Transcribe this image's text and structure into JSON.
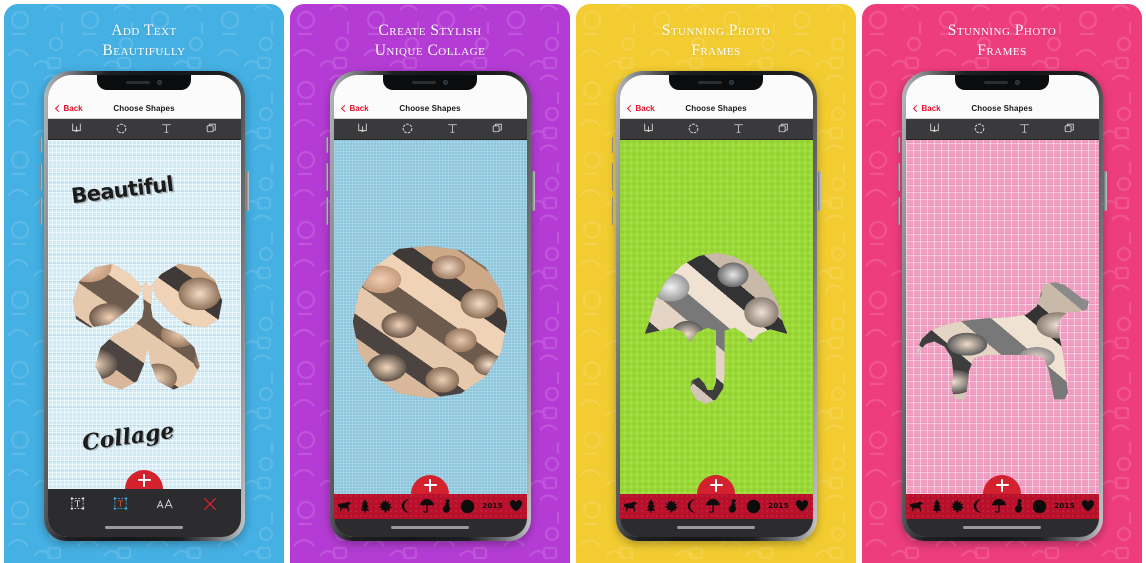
{
  "gallery": {
    "panel_count": 4,
    "panels": [
      {
        "id": "panel-1",
        "bg_color": "#45B0E3",
        "headline": {
          "line1": "Add Text",
          "line2": "Beautifully"
        },
        "phone": {
          "navbar": {
            "back_label": "Back",
            "title": "Choose Shapes"
          },
          "toolbar_icons": [
            "save-icon",
            "shape-circle-icon",
            "text-t-icon",
            "layers-icon"
          ],
          "canvas": {
            "background": "light-blue-graph-paper",
            "background_color": "#cfeaf7",
            "shape": "butterfly",
            "art_text_top": "Beautiful",
            "art_text_bottom": "Collage"
          },
          "fab_label": "+",
          "bottom_bar_type": "text-tools",
          "text_tools": [
            "text-box-white-icon",
            "text-box-orange-icon",
            "font-size-aa-icon",
            "close-x-icon"
          ]
        }
      },
      {
        "id": "panel-2",
        "bg_color": "#B43CD4",
        "headline": {
          "line1": "Create Stylish",
          "line2": "Unique Collage"
        },
        "phone": {
          "navbar": {
            "back_label": "Back",
            "title": "Choose Shapes"
          },
          "toolbar_icons": [
            "save-icon",
            "shape-circle-icon",
            "text-t-icon",
            "layers-icon"
          ],
          "canvas": {
            "background": "flat-blue-grid",
            "background_color": "#8cc6dd",
            "shape": "circle"
          },
          "fab_label": "+",
          "bottom_bar_type": "shape-picker",
          "shape_picker": {
            "bar_color": "#b8102a",
            "items": [
              "dog-icon",
              "pine-tree-icon",
              "maple-leaf-icon",
              "crescent-moon-icon",
              "umbrella-icon",
              "violin-icon",
              "circle-icon",
              "heart-icon"
            ],
            "year_label": "2015",
            "selected": "circle-icon"
          }
        }
      },
      {
        "id": "panel-3",
        "bg_color": "#F2CC30",
        "headline": {
          "line1": "Stunning Photo",
          "line2": "Frames"
        },
        "phone": {
          "navbar": {
            "back_label": "Back",
            "title": "Choose Shapes"
          },
          "toolbar_icons": [
            "save-icon",
            "shape-circle-icon",
            "text-t-icon",
            "layers-icon"
          ],
          "canvas": {
            "background": "green-halftone-dots",
            "background_color": "#9ad93a",
            "shape": "umbrella"
          },
          "fab_label": "+",
          "bottom_bar_type": "shape-picker",
          "shape_picker": {
            "bar_color": "#b8102a",
            "items": [
              "dog-icon",
              "pine-tree-icon",
              "maple-leaf-icon",
              "crescent-moon-icon",
              "umbrella-icon",
              "violin-icon",
              "circle-icon",
              "heart-icon"
            ],
            "year_label": "2015",
            "selected": "umbrella-icon"
          }
        }
      },
      {
        "id": "panel-4",
        "bg_color": "#EE3D7C",
        "headline": {
          "line1": "Stunning Photo",
          "line2": "Frames"
        },
        "phone": {
          "navbar": {
            "back_label": "Back",
            "title": "Choose Shapes"
          },
          "toolbar_icons": [
            "save-icon",
            "shape-circle-icon",
            "text-t-icon",
            "layers-icon"
          ],
          "canvas": {
            "background": "pink-waffle-weave",
            "background_color": "#f09ec2",
            "shape": "dog"
          },
          "fab_label": "+",
          "bottom_bar_type": "shape-picker",
          "shape_picker": {
            "bar_color": "#b8102a",
            "items": [
              "dog-icon",
              "pine-tree-icon",
              "maple-leaf-icon",
              "crescent-moon-icon",
              "umbrella-icon",
              "violin-icon",
              "circle-icon",
              "heart-icon"
            ],
            "year_label": "2015",
            "selected": "dog-icon"
          }
        }
      }
    ]
  },
  "colors": {
    "back_red": "#e0112b",
    "fab_red": "#d3212d",
    "toolbar_dark": "#3a3a3c",
    "bottom_dark": "#2c2c2e",
    "shape_bar_red": "#b8102a"
  }
}
